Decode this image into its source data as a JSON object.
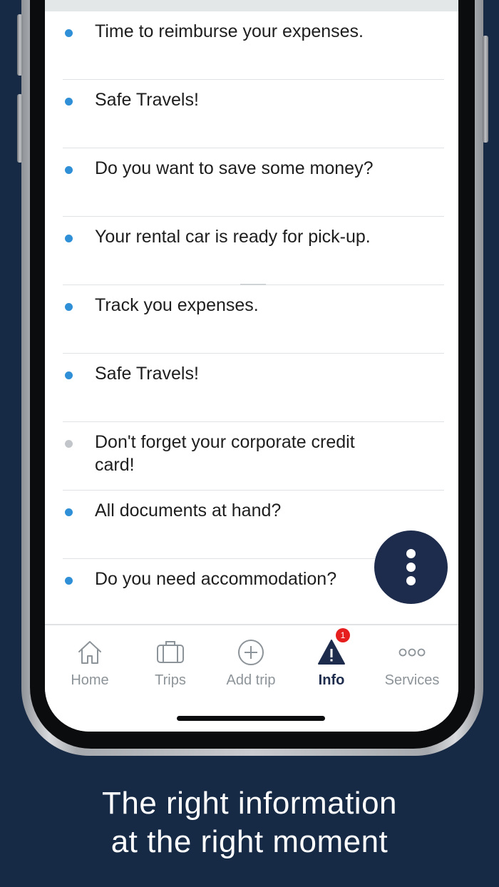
{
  "notifications": [
    {
      "text": "Time to reimburse your expenses.",
      "read": false
    },
    {
      "text": "Safe Travels!",
      "read": false
    },
    {
      "text": "Do you want to save some money?",
      "read": false
    },
    {
      "text": "Your rental car is ready for pick-up.",
      "read": false
    },
    {
      "text": "Track you expenses.",
      "read": false
    },
    {
      "text": "Safe Travels!",
      "read": false
    },
    {
      "text": "Don't forget your corporate credit card!",
      "read": true
    },
    {
      "text": "All documents at hand?",
      "read": false
    },
    {
      "text": "Do you need accommodation?",
      "read": false
    }
  ],
  "tabs": {
    "home": {
      "label": "Home",
      "icon": "home-icon"
    },
    "trips": {
      "label": "Trips",
      "icon": "suitcase-icon"
    },
    "add_trip": {
      "label": "Add trip",
      "icon": "plus-circle-icon"
    },
    "info": {
      "label": "Info",
      "icon": "warning-icon",
      "badge": "1",
      "active": true
    },
    "services": {
      "label": "Services",
      "icon": "more-dots-icon"
    }
  },
  "caption": {
    "line1": "The right information",
    "line2": "at the right moment"
  },
  "colors": {
    "background": "#172a45",
    "accent": "#1d2c4c",
    "unread_bullet": "#2f8fd7",
    "read_bullet": "#c2c6cb",
    "badge": "#e61e1e"
  }
}
